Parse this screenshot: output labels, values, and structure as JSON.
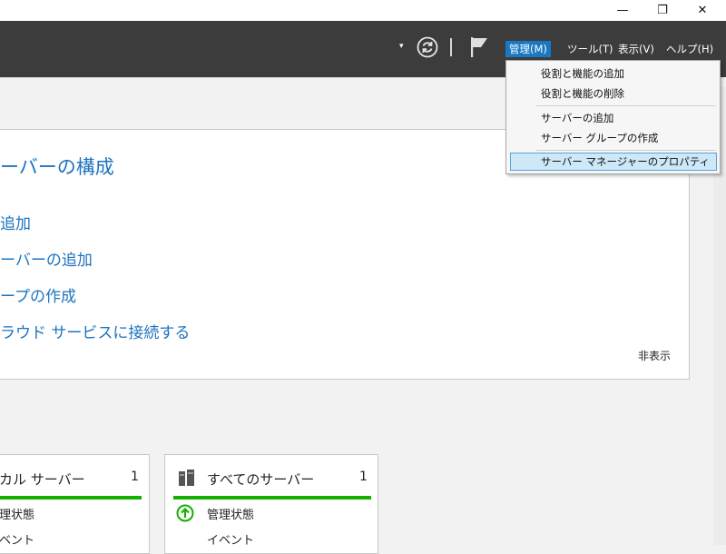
{
  "titlebar": {
    "minimize_glyph": "—",
    "restore_glyph": "❐",
    "close_glyph": "✕"
  },
  "toolbar": {
    "dropdown_caret": "▾",
    "refresh_icon": "refresh-icon",
    "flag_icon": "flag-icon",
    "menus": [
      {
        "label": "管理(M)",
        "active": true
      },
      {
        "label": "ツール(T)",
        "active": false
      },
      {
        "label": "表示(V)",
        "active": false
      },
      {
        "label": "ヘルプ(H)",
        "active": false
      }
    ]
  },
  "dropdown": {
    "items": [
      "役割と機能の追加",
      "役割と機能の削除",
      "サーバーの追加",
      "サーバー グループの作成",
      "サーバー マネージャーのプロパティ"
    ],
    "highlight_color": "#cde8f7"
  },
  "config": {
    "title": "ーバーの構成",
    "links": [
      "追加",
      "ーバーの追加",
      "ープの作成",
      "ラウド サービスに接続する"
    ],
    "hide_label": "非表示"
  },
  "tiles": [
    {
      "title": "カル サーバー",
      "count": "1",
      "rows": [
        "理状態",
        "ベント"
      ]
    },
    {
      "title": "すべてのサーバー",
      "count": "1",
      "rows": [
        "管理状態",
        "イベント"
      ]
    }
  ],
  "colors": {
    "accent": "#1e73be",
    "menu_active": "#1a78c2",
    "status_green": "#12b000",
    "toolbar_bg": "#3c3c3c"
  }
}
